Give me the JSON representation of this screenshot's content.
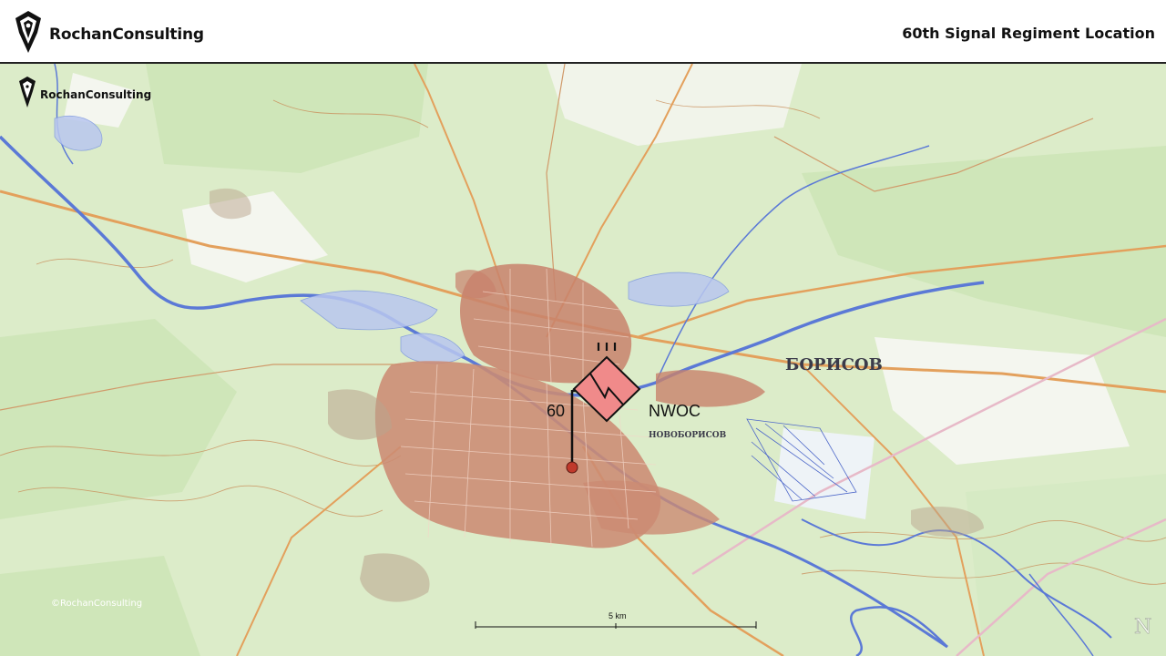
{
  "header": {
    "brand_name": "RochanConsulting",
    "title": "60th Signal Regiment Location"
  },
  "map": {
    "watermark_brand": "RochanConsulting",
    "copyright": "©RochanConsulting",
    "city_label": "БОРИСОВ",
    "district_label": "НОВОБОРИСОВ",
    "unit_symbol": {
      "unit_number": "60",
      "unit_size": "III",
      "higher_formation": "NWOC",
      "symbol_type": "signal",
      "fill_color": "#f08a8a"
    },
    "location_marker_color": "#c0392b",
    "scale_bar_label": "5 km",
    "north_arrow": "N"
  }
}
